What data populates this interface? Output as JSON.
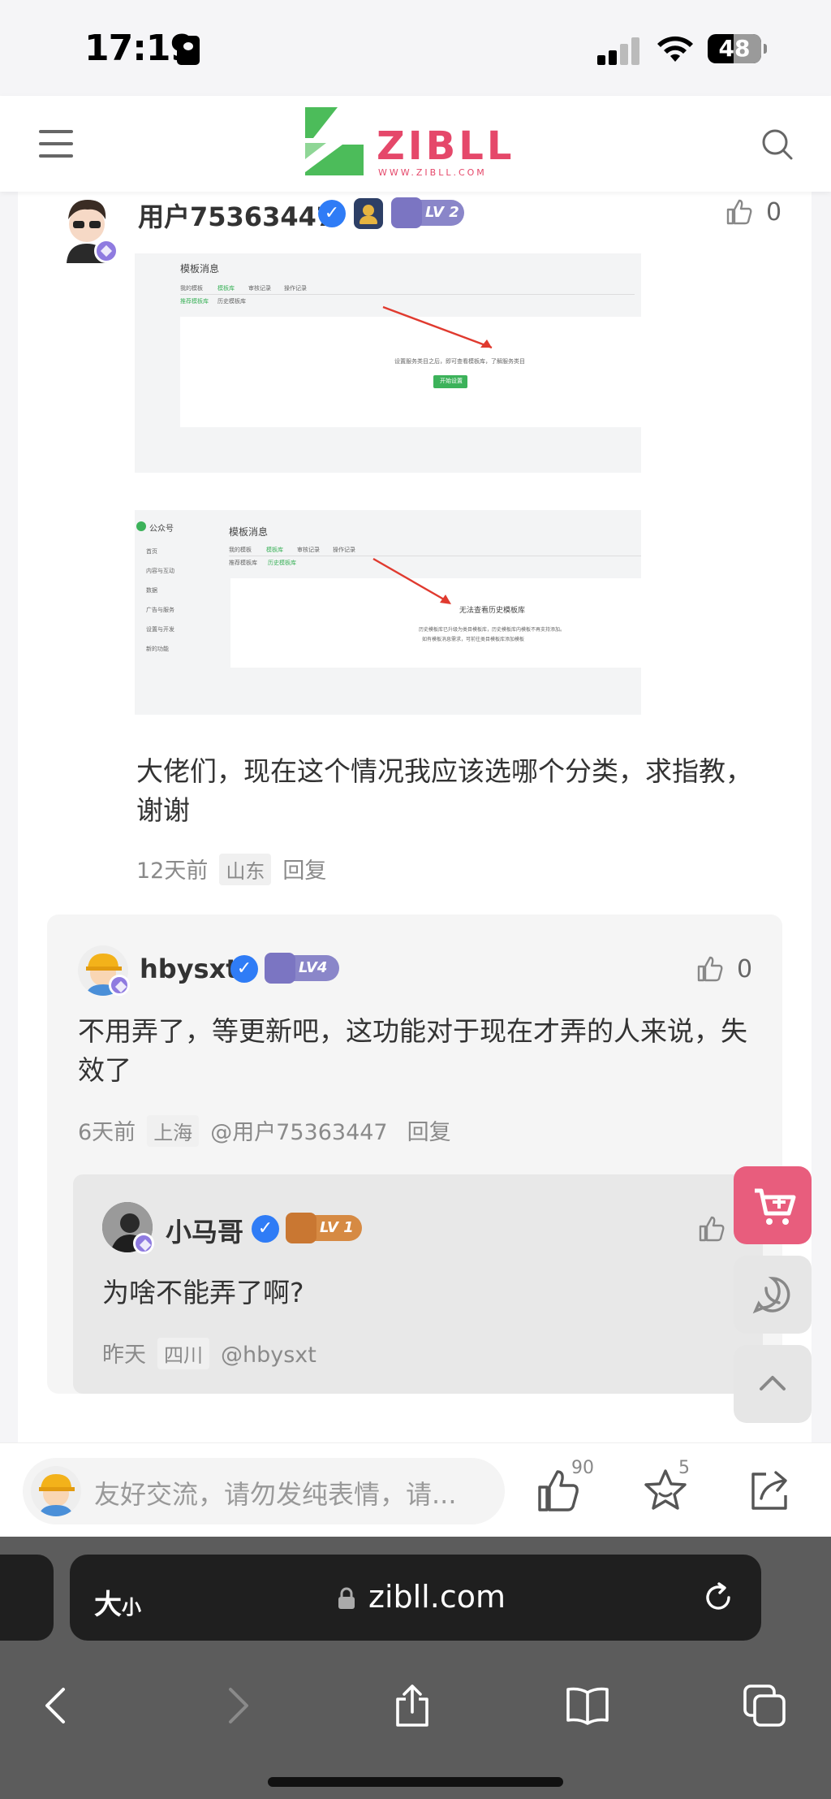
{
  "status_bar": {
    "time": "17:19",
    "battery": "48"
  },
  "header": {
    "logo_text": "ZIBLL",
    "logo_sub": "WWW.ZIBLL.COM"
  },
  "colors": {
    "brand": "#e5486a",
    "logo_green": "#4cbc5a",
    "verified": "#2f7cf6",
    "accent_pink": "#e85d7d"
  },
  "comments": [
    {
      "username": "用户75363447",
      "level": "LV 2",
      "likes": "0",
      "screenshots": [
        {
          "title": "模板消息",
          "tabs": [
            "我的模板",
            "模板库",
            "审核记录",
            "操作记录"
          ],
          "subtabs": [
            "推荐模板库",
            "历史模板库"
          ],
          "message": "设置服务类目之后，即可查看模板库，了解服务类目",
          "button": "开始设置"
        },
        {
          "brand": "公众号",
          "title": "模板消息",
          "tabs": [
            "我的模板",
            "模板库",
            "审核记录",
            "操作记录"
          ],
          "subtabs": [
            "推荐模板库",
            "历史模板库"
          ],
          "sidebar": [
            "首页",
            "内容与互动",
            "数据",
            "广告与服务",
            "设置与开发",
            "新的功能"
          ],
          "message": "无法查看历史模板库",
          "message_sub_1": "历史模板库已升级为类目模板库，历史模板库内模板不再支持添加。",
          "message_sub_2": "如有模板消息需求，可前往类目模板库添加模板"
        }
      ],
      "text": "大佬们，现在这个情况我应该选哪个分类，求指教，谢谢",
      "time": "12天前",
      "region": "山东",
      "reply_label": "回复"
    },
    {
      "username": "hbysxt",
      "level": "LV4",
      "likes": "0",
      "text": "不用弄了，等更新吧，这功能对于现在才弄的人来说，失效了",
      "time": "6天前",
      "region": "上海",
      "mention": "@用户75363447",
      "reply_label": "回复"
    },
    {
      "username": "小马哥",
      "level": "LV 1",
      "text": "为啥不能弄了啊?",
      "time": "昨天",
      "region": "四川",
      "mention": "@hbysxt"
    }
  ],
  "comment_bar": {
    "placeholder": "友好交流，请勿发纯表情，请...",
    "like_count": "90",
    "favorite_count": "5"
  },
  "browser": {
    "text_size_label": "大",
    "text_size_small": "小",
    "url": "zibll.com"
  }
}
